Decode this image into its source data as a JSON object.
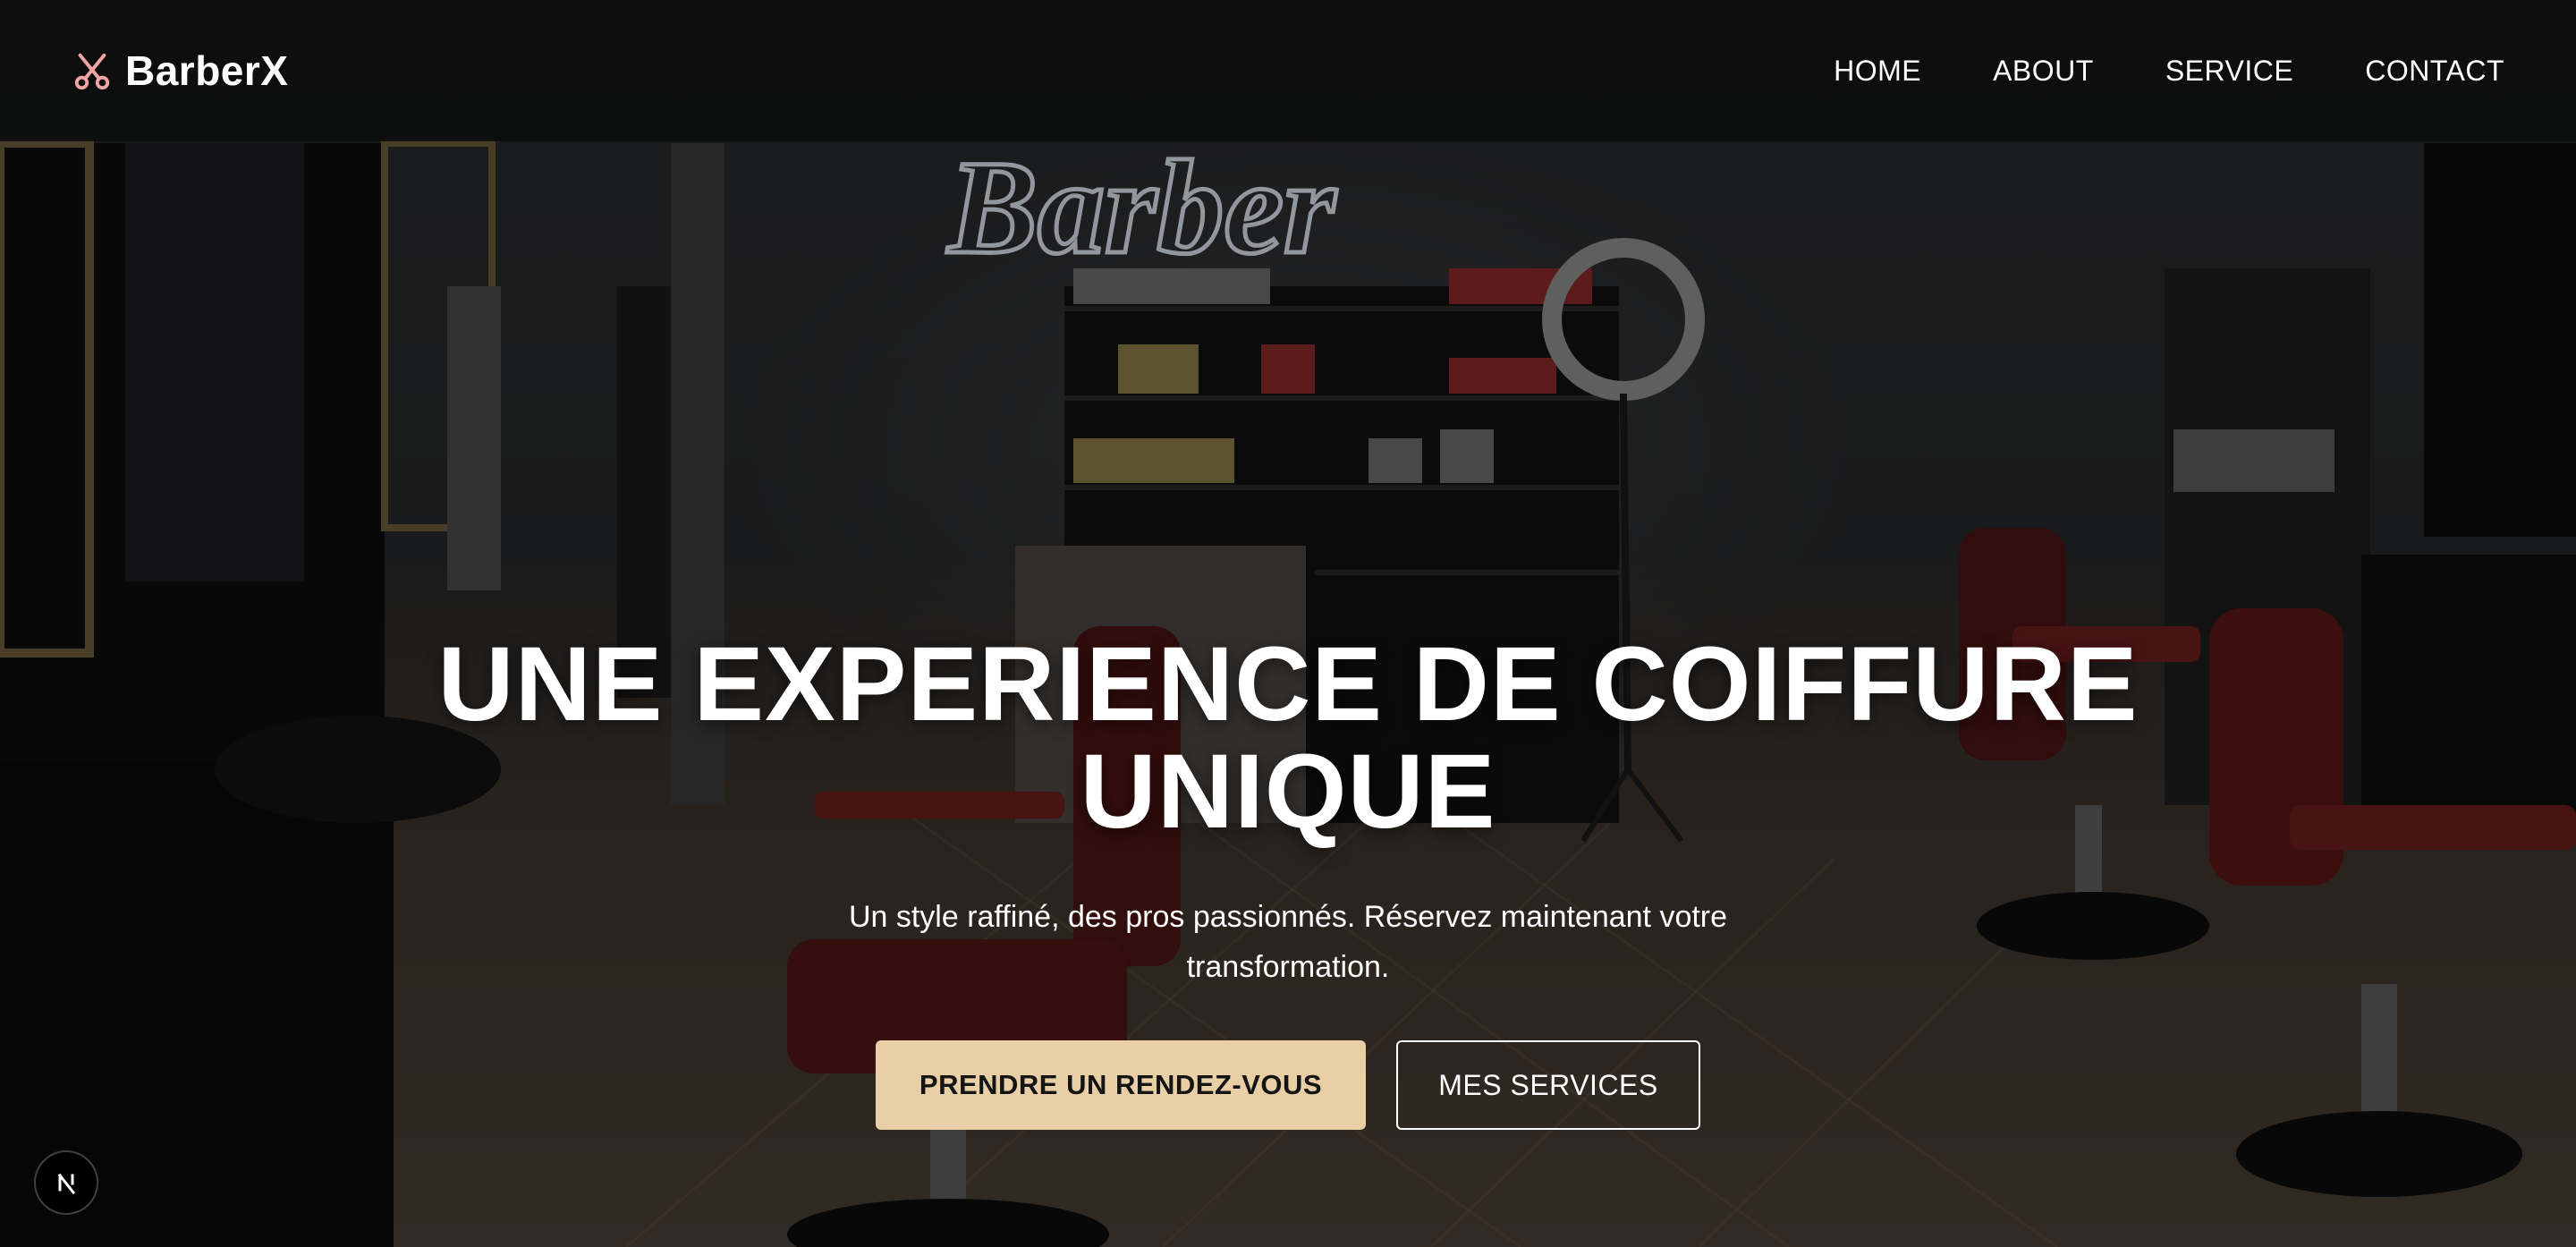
{
  "brand": {
    "name": "BarberX",
    "icon": "scissors-icon",
    "icon_color": "#f2a5a5"
  },
  "nav": {
    "items": [
      {
        "label": "HOME"
      },
      {
        "label": "ABOUT"
      },
      {
        "label": "SERVICE"
      },
      {
        "label": "CONTACT"
      }
    ]
  },
  "hero": {
    "title_line1": "UNE EXPERIENCE DE COIFFURE",
    "title_line2": "UNIQUE",
    "subtitle": "Un style raffiné, des pros passionnés. Réservez maintenant votre transformation.",
    "primary_button": "PRENDRE UN RENDEZ-VOUS",
    "secondary_button": "MES SERVICES"
  },
  "background": {
    "sign_text": "Barber"
  },
  "dev_badge": {
    "icon": "nextjs-logo-icon"
  },
  "colors": {
    "accent": "#e8cfa6",
    "navbar": "#0c0c0c",
    "text": "#ffffff"
  }
}
